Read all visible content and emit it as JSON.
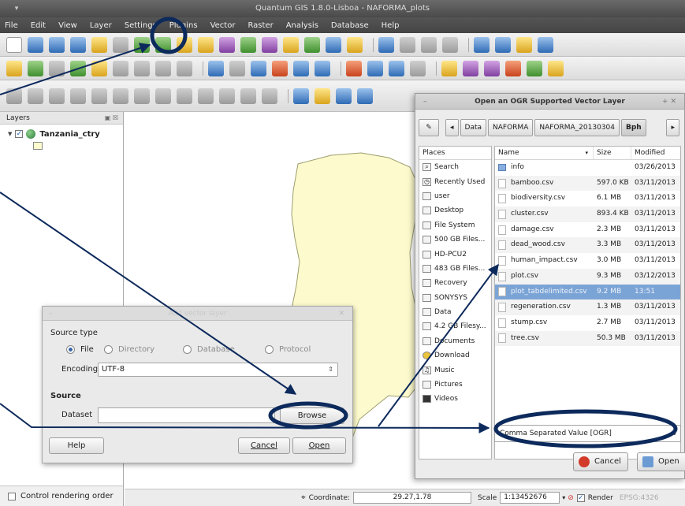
{
  "window": {
    "title": "Quantum GIS 1.8.0-Lisboa - NAFORMA_plots"
  },
  "menu": [
    "File",
    "Edit",
    "View",
    "Layer",
    "Settings",
    "Plugins",
    "Vector",
    "Raster",
    "Analysis",
    "Database",
    "Help"
  ],
  "layers_panel": {
    "title": "Layers",
    "layer_name": "Tanzania_ctry",
    "control_rendering_order": "Control rendering order"
  },
  "status": {
    "coordinate_label": "Coordinate:",
    "coordinate_value": "29.27,1.78",
    "scale_label": "Scale",
    "scale_value": "1:13452676",
    "render_label": "Render",
    "epsg": "EPSG:4326"
  },
  "add_dialog": {
    "title": "Add vector layer",
    "source_type_label": "Source type",
    "radios": [
      "File",
      "Directory",
      "Database",
      "Protocol"
    ],
    "encoding_label": "Encoding",
    "encoding_value": "UTF-8",
    "source_label": "Source",
    "dataset_label": "Dataset",
    "browse": "Browse",
    "help": "Help",
    "cancel": "Cancel",
    "open": "Open"
  },
  "ogr_dialog": {
    "title": "Open an OGR Supported Vector Layer",
    "path": [
      "Data",
      "NAFORMA",
      "NAFORMA_20130304",
      "Bph"
    ],
    "places_header": "Places",
    "places": [
      "Search",
      "Recently Used",
      "user",
      "Desktop",
      "File System",
      "500 GB Files...",
      "HD-PCU2",
      "483 GB Files...",
      "Recovery",
      "SONYSYS",
      "Data",
      "4.2 GB Filesy...",
      "Documents",
      "Download",
      "Music",
      "Pictures",
      "Videos"
    ],
    "columns": [
      "Name",
      "Size",
      "Modified"
    ],
    "files": [
      {
        "name": "info",
        "size": "",
        "modified": "03/26/2013",
        "folder": true
      },
      {
        "name": "bamboo.csv",
        "size": "597.0 KB",
        "modified": "03/11/2013"
      },
      {
        "name": "biodiversity.csv",
        "size": "6.1 MB",
        "modified": "03/11/2013"
      },
      {
        "name": "cluster.csv",
        "size": "893.4 KB",
        "modified": "03/11/2013"
      },
      {
        "name": "damage.csv",
        "size": "2.3 MB",
        "modified": "03/11/2013"
      },
      {
        "name": "dead_wood.csv",
        "size": "3.3 MB",
        "modified": "03/11/2013"
      },
      {
        "name": "human_impact.csv",
        "size": "3.0 MB",
        "modified": "03/11/2013"
      },
      {
        "name": "plot.csv",
        "size": "9.3 MB",
        "modified": "03/12/2013"
      },
      {
        "name": "plot_tabdelimited.csv",
        "size": "9.2 MB",
        "modified": "13:51",
        "selected": true
      },
      {
        "name": "regeneration.csv",
        "size": "1.3 MB",
        "modified": "03/11/2013"
      },
      {
        "name": "stump.csv",
        "size": "2.7 MB",
        "modified": "03/11/2013"
      },
      {
        "name": "tree.csv",
        "size": "50.3 MB",
        "modified": "03/11/2013"
      }
    ],
    "filter": "Comma Separated Value [OGR]",
    "cancel": "Cancel",
    "open": "Open"
  },
  "colors": {
    "map_fill": "#fdfbcd",
    "map_stroke": "#9d9d6e",
    "annotation": "#0d2a5c",
    "selection": "#7ba4d6"
  }
}
